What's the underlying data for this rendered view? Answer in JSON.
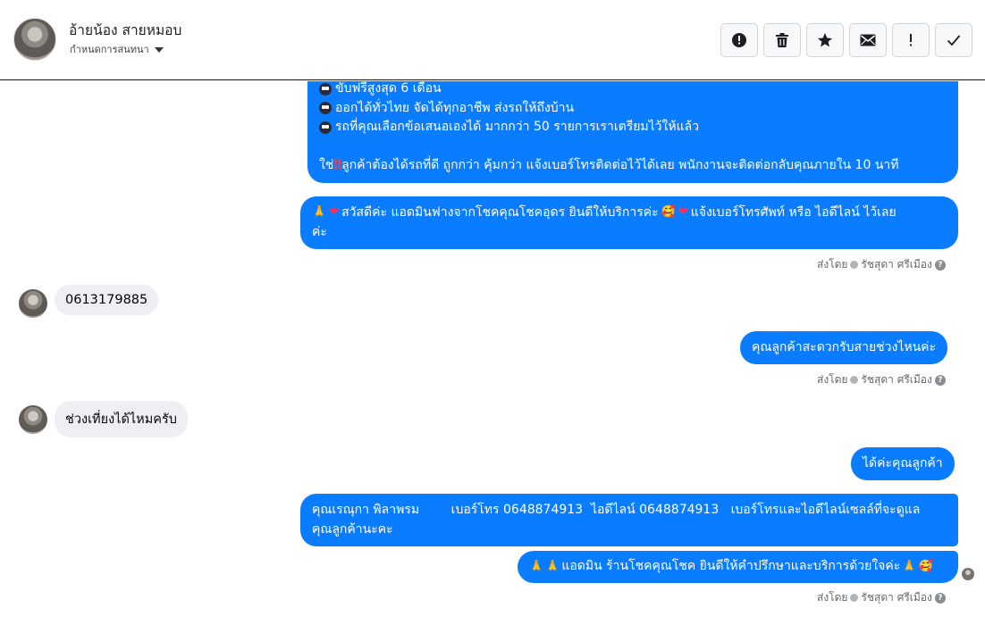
{
  "header": {
    "contact_name": "อ้ายน้อง สายหมอบ",
    "conversation_setting": "กำหนดการสนทนา"
  },
  "toolbar": {
    "buttons": [
      {
        "name": "spam-button",
        "icon": "alert-circle-icon"
      },
      {
        "name": "delete-button",
        "icon": "trash-icon"
      },
      {
        "name": "star-button",
        "icon": "star-icon"
      },
      {
        "name": "mail-button",
        "icon": "envelope-icon"
      },
      {
        "name": "important-button",
        "icon": "exclamation-icon"
      },
      {
        "name": "done-button",
        "icon": "checkmark-icon"
      }
    ]
  },
  "colors": {
    "outgoing_bubble": "#0a7cff",
    "incoming_bubble": "#eeeff2",
    "meta_text": "#65676b"
  },
  "messages": {
    "promo": {
      "line1": "ขับฟรีสูงสุด 6 เดือน",
      "line2": "ออกได้ทั่วไทย จัดได้ทุกอาชีพ ส่งรถให้ถึงบ้าน",
      "line3": "รถที่คุณเลือกข้อเสนอเองได้ มากกว่า 50 รายการเราเตรียมไว้ให้แล้ว",
      "line4_prefix": "ใช่",
      "line4_text": "ลูกค้าต้องได้รถที่ดี ถูกกว่า คุ้มกว่า แจ้งเบอร์โทรติดต่อไว้ได้เลย พนักงานจะติดต่อกลับคุณภายใน 10 นาที"
    },
    "greeting": {
      "text1": "สวัสดีค่ะ แอดมินฟางจากโชคคุณโชคอุดร ยินดีให้บริการค่ะ",
      "text2": "แจ้งเบอร์โทรศัพท์ หรือ ไอดีไลน์  ไว้เลย",
      "text3": "ค่ะ"
    },
    "customer_phone": "0613179885",
    "ask_time": "คุณลูกค้าสะดวกรับสายช่วงไหนค่ะ",
    "customer_time": "ช่วงเที่ยงได้ไหมครับ",
    "ok_reply": "ได้ค่ะคุณลูกค้า",
    "contact_info": {
      "line1": "คุณเรณุกา พิลาพรม        เบอร์โทร 0648874913  ไอดีไลน์ 0648874913   เบอร์โทรและไอดีไลน์เซลล์ที่จะดูแล",
      "line2": "คุณลูกค้านะคะ"
    },
    "closing": "แอดมิน ร้านโชคคุณโชค ยินดีให้คำปรึกษาและบริการด้วยใจค่ะ"
  },
  "sent_by": {
    "label": "ส่งโดย",
    "agent": "รัชสุดา ศรีเมือง"
  }
}
